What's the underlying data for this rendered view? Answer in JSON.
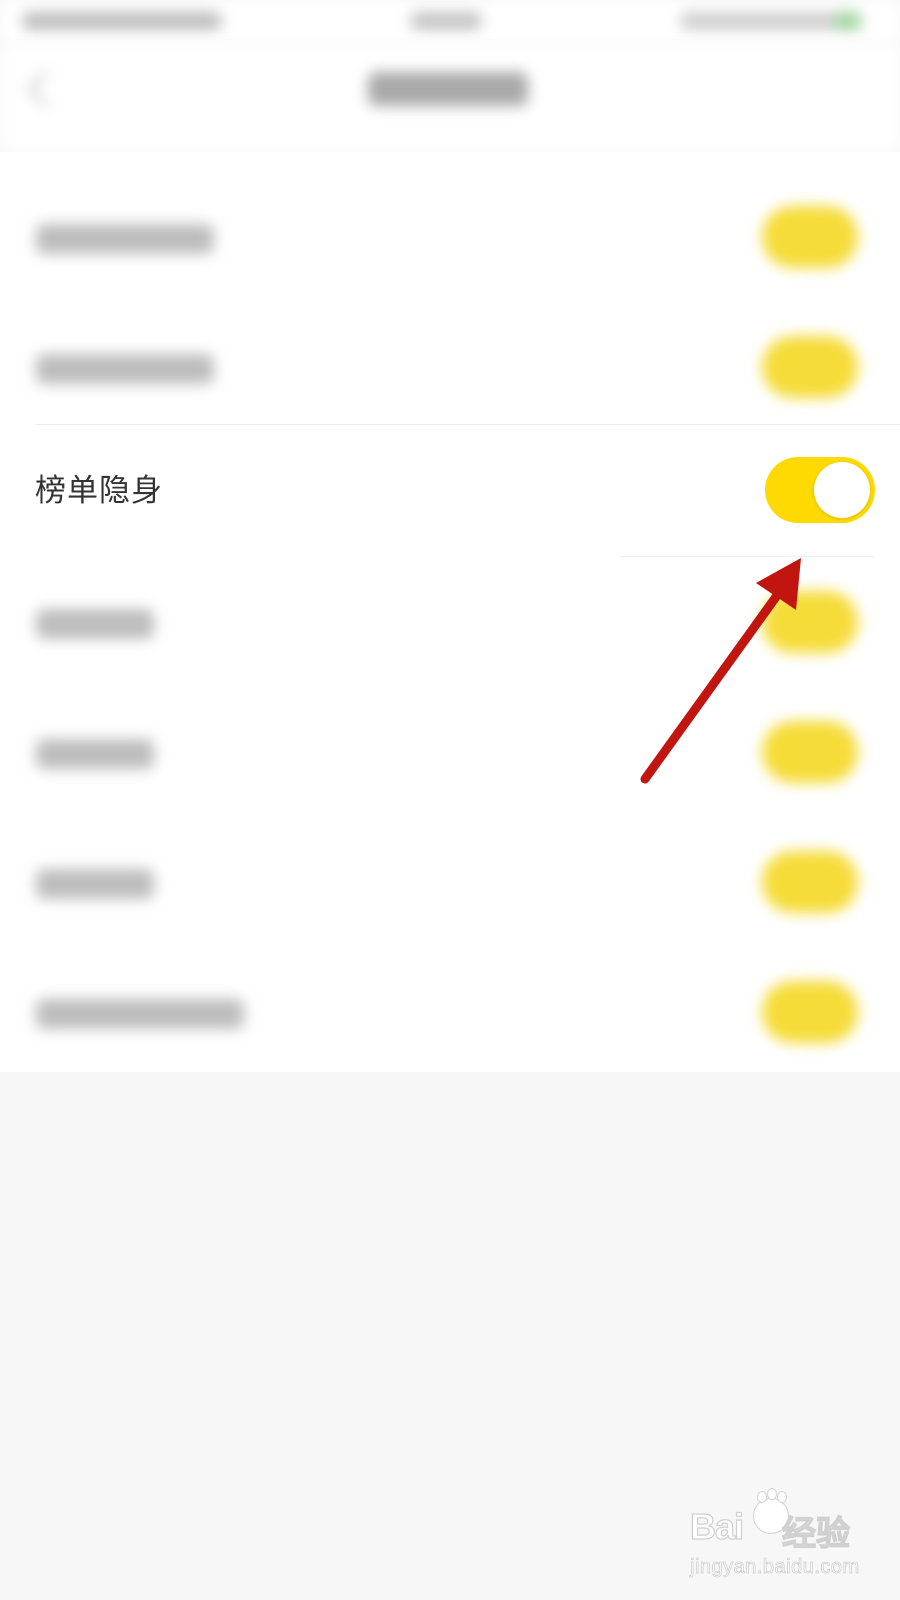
{
  "setting": {
    "label": "榜单隐身",
    "enabled": true
  },
  "colors": {
    "toggle_on": "#fed902",
    "arrow": "#c0160f",
    "background": "#f7f7f7"
  },
  "icons": {
    "back": "back-chevron-icon",
    "annotation": "red-arrow"
  },
  "watermark": {
    "logo": "Bai",
    "logo_suffix": "经验",
    "url": "jingyan.baidu.com"
  }
}
